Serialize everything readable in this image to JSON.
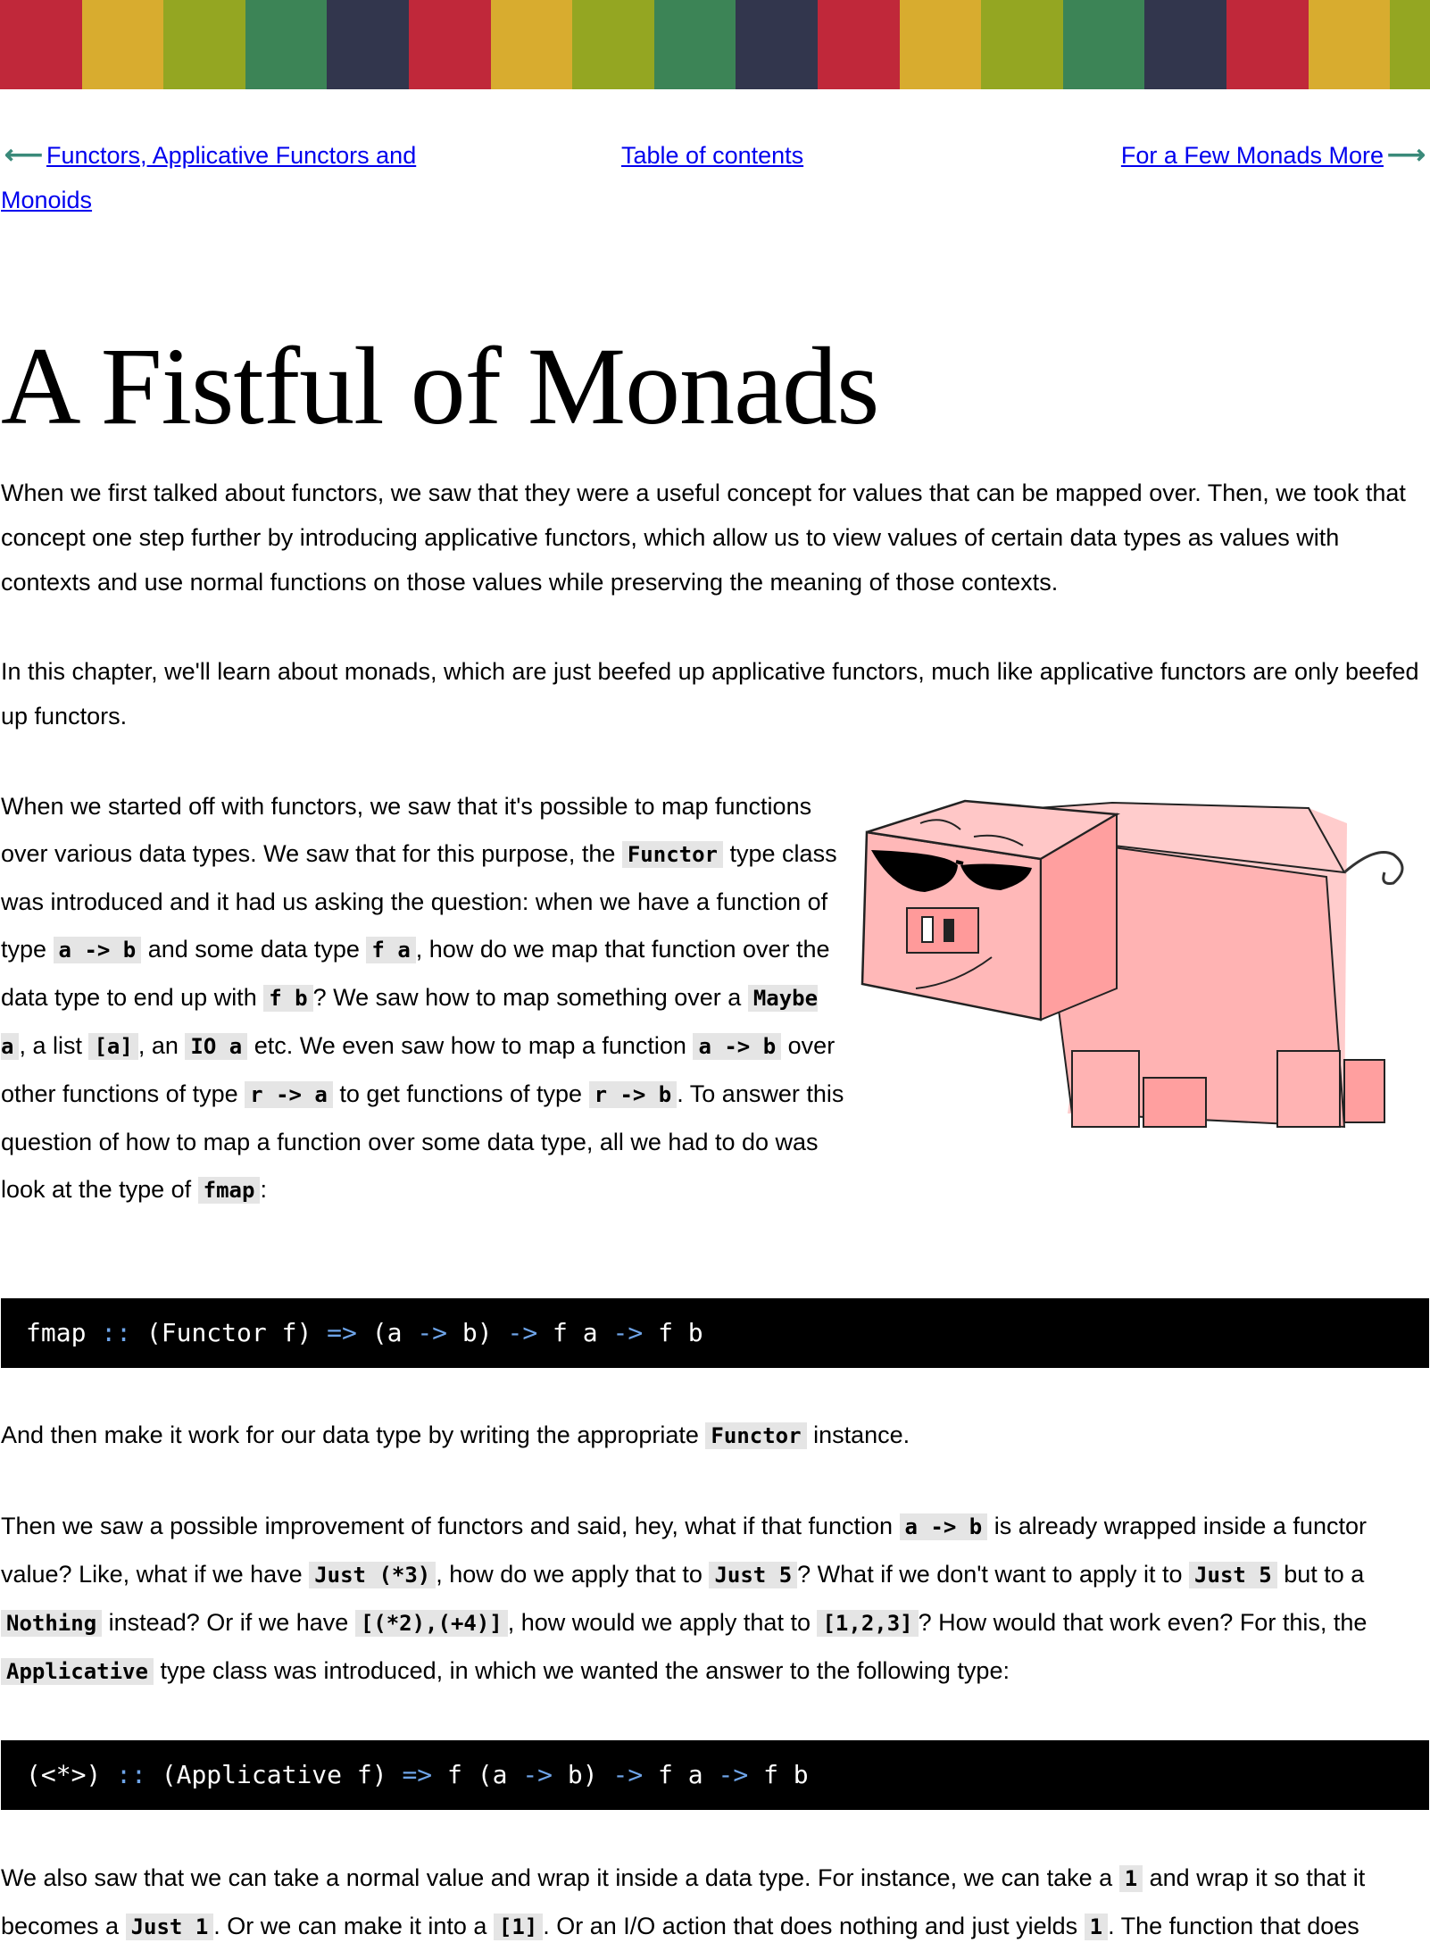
{
  "stripe_colors": [
    "#c0283a",
    "#d8ac2f",
    "#94a622",
    "#3c8456",
    "#32364d",
    "#c0283a",
    "#d8ac2f",
    "#94a622",
    "#3c8456",
    "#32364d",
    "#c0283a",
    "#d8ac2f",
    "#94a622",
    "#3c8456",
    "#32364d",
    "#c0283a",
    "#d8ac2f",
    "#94a622"
  ],
  "nav": {
    "prev_label": "Functors, Applicative Functors and Monoids",
    "toc_label": "Table of contents",
    "next_label": "For a Few Monads More"
  },
  "title": "A Fistful of Monads",
  "para1": "When we first talked about functors, we saw that they were a useful concept for values that can be mapped over. Then, we took that concept one step further by introducing applicative functors, which allow us to view values of certain data types as values with contexts and use normal functions on those values while preserving the meaning of those contexts.",
  "para2": "In this chapter, we'll learn about monads, which are just beefed up applicative functors, much like applicative functors are only beefed up functors.",
  "para3": {
    "t1": "When we started off with functors, we saw that it's possible to map functions over various data types. We saw that for this purpose, the ",
    "c1": "Functor",
    "t2": " type class was introduced and it had us asking the question: when we have a function of type ",
    "c2": "a -> b",
    "t3": " and some data type ",
    "c3": "f a",
    "t4": ", how do we map that function over the data type to end up with ",
    "c4": "f b",
    "t5": "? We saw how to map something over a ",
    "c5": "Maybe a",
    "t6": ", a list ",
    "c6": "[a]",
    "t7": ", an ",
    "c7": "IO a",
    "t8": " etc. We even saw how to map a function ",
    "c8": "a -> b",
    "t9": " over other functions of type ",
    "c9": "r -> a",
    "t10": " to get functions of type ",
    "c10": "r -> b",
    "t11": ". To answer this question of how to map a function over some data type, all we had to do was look at the type of ",
    "c11": "fmap",
    "t12": ":"
  },
  "code1": {
    "a": "fmap ",
    "b": "::",
    "c": " (Functor f) ",
    "d": "=>",
    "e": " (a ",
    "f": "->",
    "g": " b) ",
    "h": "->",
    "i": " f a ",
    "j": "->",
    "k": " f b"
  },
  "para4": {
    "t1": "And then make it work for our data type by writing the appropriate ",
    "c1": "Functor",
    "t2": " instance."
  },
  "para5": {
    "t1": "Then we saw a possible improvement of functors and said, hey, what if that function ",
    "c1": "a -> b",
    "t2": " is already wrapped inside a functor value? Like, what if we have ",
    "c2": "Just (*3)",
    "t3": ", how do we apply that to ",
    "c3": "Just 5",
    "t4": "? What if we don't want to apply it to ",
    "c4": "Just 5",
    "t5": " but to a ",
    "c5": "Nothing",
    "t6": " instead? Or if we have ",
    "c6": "[(*2),(+4)]",
    "t7": ", how would we apply that to ",
    "c7": "[1,2,3]",
    "t8": "? How would that work even? For this, the ",
    "c8": "Applicative",
    "t9": " type class was introduced, in which we wanted the answer to the following type:"
  },
  "code2": {
    "a": "(<*>) ",
    "b": "::",
    "c": " (Applicative f) ",
    "d": "=>",
    "e": " f (a ",
    "f": "->",
    "g": " b) ",
    "h": "->",
    "i": " f a ",
    "j": "->",
    "k": " f b"
  },
  "para6": {
    "t1": "We also saw that we can take a normal value and wrap it inside a data type. For instance, we can take a ",
    "c1": "1",
    "t2": " and wrap it so that it becomes a ",
    "c2": "Just 1",
    "t3": ". Or we can make it into a ",
    "c3": "[1]",
    "t4": ". Or an I/O action that does nothing and just yields ",
    "c4": "1",
    "t5": ". The function that does"
  }
}
